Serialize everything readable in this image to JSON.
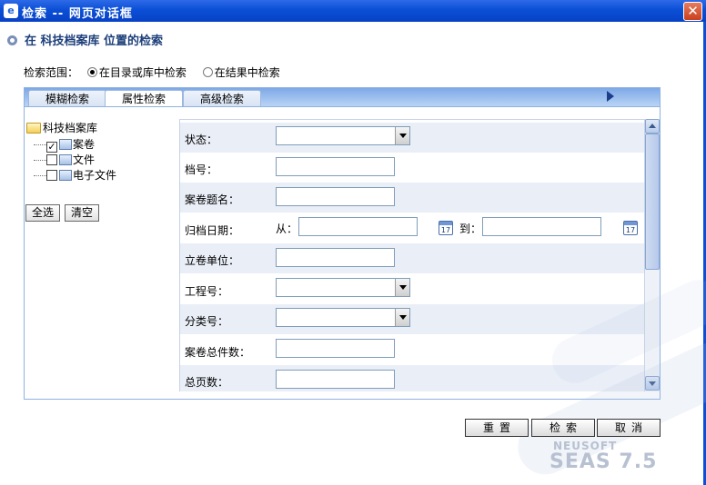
{
  "window": {
    "title": "检索 -- 网页对话框",
    "close_glyph": "✕",
    "app_icon": "e"
  },
  "heading": "在 科技档案库 位置的检索",
  "scope": {
    "label": "检索范围：",
    "options": [
      {
        "label": "在目录或库中检索",
        "selected": true
      },
      {
        "label": "在结果中检索",
        "selected": false
      }
    ]
  },
  "tabs": [
    {
      "label": "模糊检索",
      "active": false
    },
    {
      "label": "属性检索",
      "active": true
    },
    {
      "label": "高级检索",
      "active": false
    }
  ],
  "tree": {
    "root": "科技档案库",
    "nodes": [
      {
        "label": "案卷",
        "checked": true
      },
      {
        "label": "文件",
        "checked": false
      },
      {
        "label": "电子文件",
        "checked": false
      }
    ],
    "select_all": "全选",
    "clear": "清空"
  },
  "form": {
    "status": "状态：",
    "file_no": "档号：",
    "volume_title": "案卷题名：",
    "archive_date": "归档日期：",
    "from": "从：",
    "to": "到：",
    "calendar_glyph": "17",
    "unit": "立卷单位：",
    "project_no": "工程号：",
    "category_no": "分类号：",
    "total_items": "案卷总件数：",
    "total_pages": "总页数："
  },
  "actions": {
    "reset": "重置",
    "search": "检索",
    "cancel": "取消"
  },
  "brand": {
    "company": "NEUSOFT",
    "product": "SEAS 7.5"
  }
}
